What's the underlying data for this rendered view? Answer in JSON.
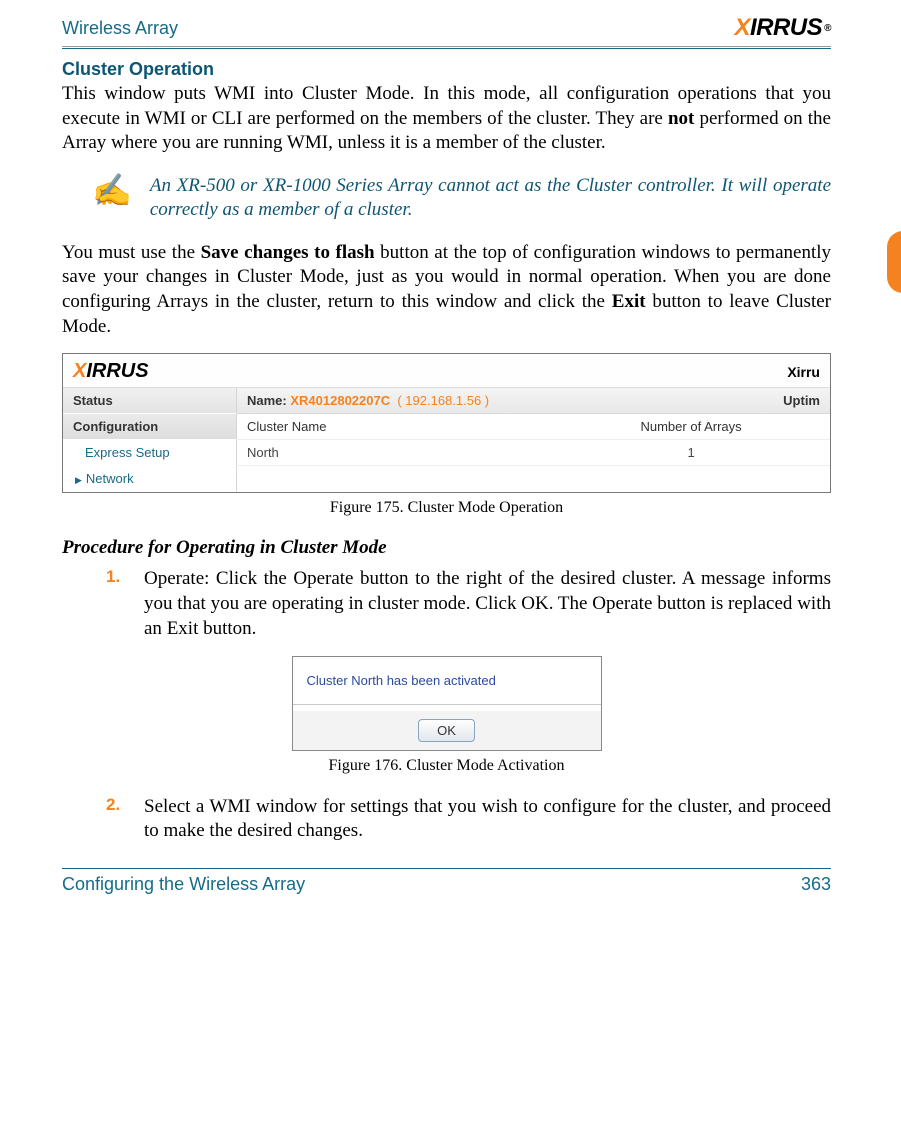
{
  "header": {
    "title": "Wireless Array",
    "brand": "IRRUS"
  },
  "section": {
    "title": "Cluster Operation"
  },
  "para1_a": "This window puts WMI into Cluster Mode. In this mode, all configuration operations that you execute in WMI or CLI are performed on the members of the cluster. They are ",
  "para1_bold1": "not",
  "para1_b": " performed on the Array where you are running WMI, unless it is a member of the cluster.",
  "note": "An XR-500 or XR-1000 Series Array cannot act as the Cluster controller. It will operate correctly as a member of a cluster.",
  "para2_a": "You must use the ",
  "para2_bold1": "Save changes to flash",
  "para2_b": " button at the top of configuration windows to permanently save your changes in Cluster Mode, just as you would in normal operation. When you are done configuring Arrays in the cluster, return to this window and click the ",
  "para2_bold2": "Exit",
  "para2_c": " button to leave Cluster Mode.",
  "fig1": {
    "brand": "IRRUS",
    "right_title": "Xirru",
    "side": {
      "status": "Status",
      "config": "Configuration",
      "express": "Express Setup",
      "network": "Network"
    },
    "name_label": "Name: ",
    "name_value": "XR4012802207C",
    "ip": "( 192.168.1.56 )",
    "uptime": "Uptim",
    "col_a": "Cluster Name",
    "col_b": "Number of Arrays",
    "row_a": "North",
    "row_b": "1",
    "caption": "Figure 175. Cluster Mode Operation"
  },
  "subheading": "Procedure for Operating in Cluster Mode",
  "proc1": {
    "num": "1.",
    "lead": "Operate:",
    "a": " Click the ",
    "b1": "Operate",
    "b": " button to the right of the desired cluster. A message informs you that you are operating in cluster mode. Click ",
    "b2": "OK",
    "c": ". The ",
    "b3": "Operate",
    "d": " button is replaced with an ",
    "b4": "Exit",
    "e": " button."
  },
  "fig2": {
    "msg": "Cluster North has been activated",
    "ok": "OK",
    "caption": "Figure 176. Cluster Mode Activation"
  },
  "proc2": {
    "num": "2.",
    "text": "Select a WMI window for settings that you wish to configure for the cluster, and proceed to make the desired changes."
  },
  "footer": {
    "left": "Configuring the Wireless Array",
    "right": "363"
  }
}
